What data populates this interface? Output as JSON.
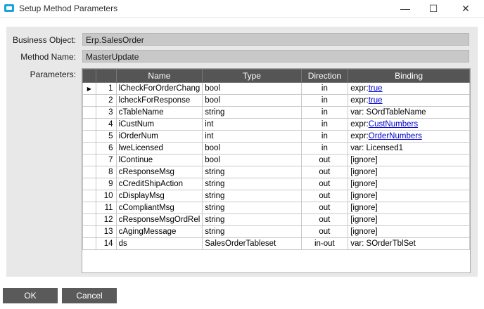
{
  "window": {
    "title": "Setup Method Parameters",
    "minimize_glyph": "—",
    "maximize_glyph": "☐",
    "close_glyph": "✕"
  },
  "form": {
    "business_object_label": "Business Object:",
    "business_object_value": "Erp.SalesOrder",
    "method_name_label": "Method Name:",
    "method_name_value": "MasterUpdate",
    "parameters_label": "Parameters:"
  },
  "grid": {
    "columns": [
      "",
      "",
      "Name",
      "Type",
      "Direction",
      "Binding"
    ],
    "current_row_indicator": "▶",
    "rows": [
      {
        "num": "1",
        "name": "lCheckForOrderChang",
        "type": "bool",
        "direction": "in",
        "binding_prefix": "expr:",
        "binding_link": "true",
        "binding_text": ""
      },
      {
        "num": "2",
        "name": "lcheckForResponse",
        "type": "bool",
        "direction": "in",
        "binding_prefix": "expr:",
        "binding_link": "true",
        "binding_text": ""
      },
      {
        "num": "3",
        "name": "cTableName",
        "type": "string",
        "direction": "in",
        "binding_prefix": "",
        "binding_link": "",
        "binding_text": "var: SOrdTableName"
      },
      {
        "num": "4",
        "name": "iCustNum",
        "type": "int",
        "direction": "in",
        "binding_prefix": "expr:",
        "binding_link": "CustNumbers",
        "binding_text": ""
      },
      {
        "num": "5",
        "name": "iOrderNum",
        "type": "int",
        "direction": "in",
        "binding_prefix": "expr:",
        "binding_link": "OrderNumbers",
        "binding_text": ""
      },
      {
        "num": "6",
        "name": "lweLicensed",
        "type": "bool",
        "direction": "in",
        "binding_prefix": "",
        "binding_link": "",
        "binding_text": "var: Licensed1"
      },
      {
        "num": "7",
        "name": "lContinue",
        "type": "bool",
        "direction": "out",
        "binding_prefix": "",
        "binding_link": "",
        "binding_text": "[ignore]"
      },
      {
        "num": "8",
        "name": "cResponseMsg",
        "type": "string",
        "direction": "out",
        "binding_prefix": "",
        "binding_link": "",
        "binding_text": "[ignore]"
      },
      {
        "num": "9",
        "name": "cCreditShipAction",
        "type": "string",
        "direction": "out",
        "binding_prefix": "",
        "binding_link": "",
        "binding_text": "[ignore]"
      },
      {
        "num": "10",
        "name": "cDisplayMsg",
        "type": "string",
        "direction": "out",
        "binding_prefix": "",
        "binding_link": "",
        "binding_text": "[ignore]"
      },
      {
        "num": "11",
        "name": "cCompliantMsg",
        "type": "string",
        "direction": "out",
        "binding_prefix": "",
        "binding_link": "",
        "binding_text": "[ignore]"
      },
      {
        "num": "12",
        "name": "cResponseMsgOrdRel",
        "type": "string",
        "direction": "out",
        "binding_prefix": "",
        "binding_link": "",
        "binding_text": "[ignore]"
      },
      {
        "num": "13",
        "name": "cAgingMessage",
        "type": "string",
        "direction": "out",
        "binding_prefix": "",
        "binding_link": "",
        "binding_text": "[ignore]"
      },
      {
        "num": "14",
        "name": "ds",
        "type": "SalesOrderTableset",
        "direction": "in-out",
        "binding_prefix": "",
        "binding_link": "",
        "binding_text": "var: SOrderTblSet"
      }
    ]
  },
  "buttons": {
    "ok_label": "OK",
    "cancel_label": "Cancel"
  },
  "colors": {
    "header_bg": "#555555",
    "button_bg": "#5a5a5a",
    "link": "#0000cc",
    "panel_bg": "#e8e8e8",
    "readonly_field_bg": "#c8c8c8"
  }
}
